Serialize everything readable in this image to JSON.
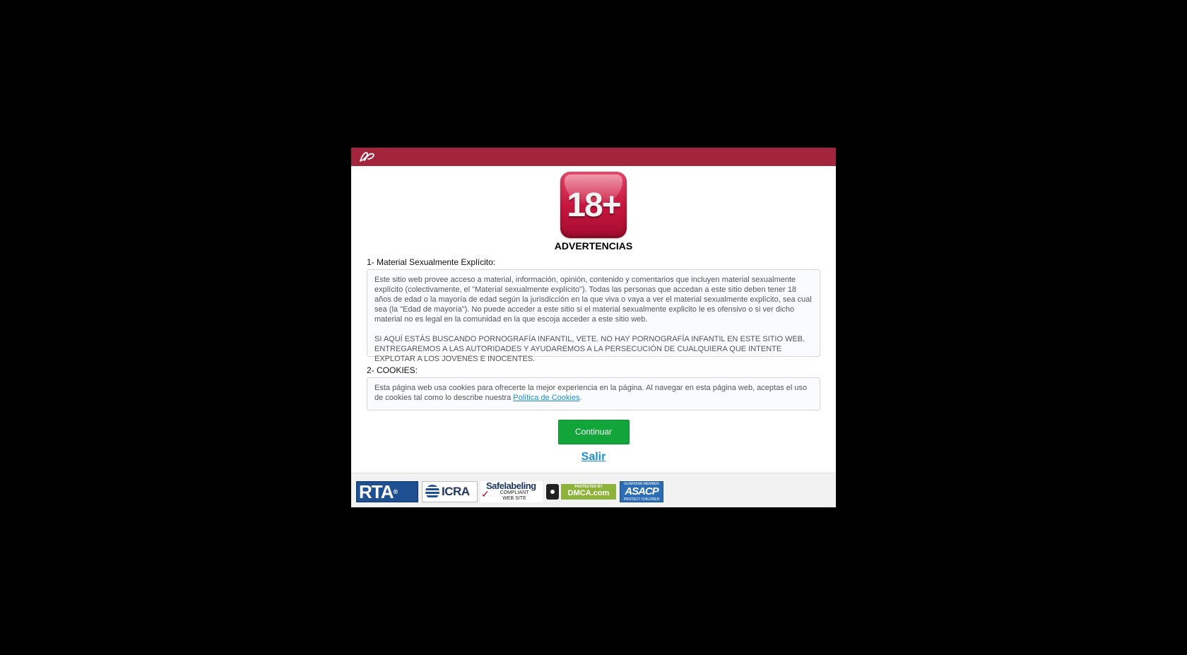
{
  "modal": {
    "age_badge": "18+",
    "title": "ADVERTENCIAS",
    "section1": {
      "label": "1- Material Sexualmente Explícito:",
      "paragraph1": "Este sitio web provee acceso a material, información, opinión, contenido y comentarios que incluyen material sexualmente explícito (colectivamente, el \"Material sexualmente explícito\"). Todas las personas que accedan a este sitio deben tener 18 años de edad o la mayoría de edad según la jurisdicción en la que viva o vaya a ver el material sexualmente explícito, sea cual sea (la \"Edad de mayoría\"). No puede acceder a este sitio si el material sexualmente explicito le es ofensivo o si ver dicho material no es legal en la comunidad en la que escoja acceder a este sitio web.",
      "paragraph2": "SI AQUÍ ESTÁS BUSCANDO PORNOGRAFÍA INFANTIL, VETE. NO HAY PORNOGRAFÍA INFANTIL EN ESTE SITIO WEB. ENTREGAREMOS A LAS AUTORIDADES Y AYUDAREMOS A LA PERSECUCIÓN DE CUALQUIERA QUE INTENTE EXPLOTAR A LOS JOVENES E INOCENTES."
    },
    "section2": {
      "label": "2- COOKIES:",
      "text_before": "Esta página web usa cookies para ofrecerte la mejor experiencia en la página. Al navegar en esta página web, aceptas el uso de cookies tal como lo describe nuestra ",
      "link_text": "Política de Cookies",
      "text_after": "."
    },
    "continue_label": "Continuar",
    "exit_label": "Salir"
  },
  "footer": {
    "badges": {
      "rta": "RTA",
      "rta_mark": "®",
      "icra": "ICRA",
      "safelabeling_title": "Safelabeling",
      "safelabeling_sub1": "COMPLIANT",
      "safelabeling_sub2": "WEB SITE",
      "dmca_top": "PROTECTED BY",
      "dmca": "DMCA.com",
      "asacp_top": "GUARDIAN MEMBER",
      "asacp": "ASACP",
      "asacp_bottom": "PROTECT CHILDREN"
    }
  },
  "colors": {
    "header": "#a3253b",
    "button": "#12a53a",
    "link": "#1a8fd8"
  }
}
